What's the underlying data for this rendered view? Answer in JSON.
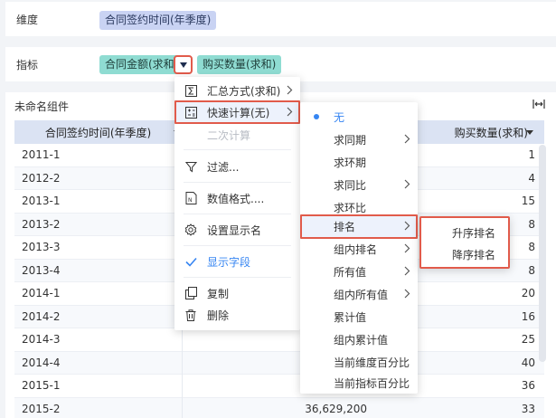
{
  "dimension_row": {
    "label": "维度",
    "field": "合同签约时间(年季度)"
  },
  "metric_row": {
    "label": "指标",
    "fields": [
      "合同金额(求和)",
      "购买数量(求和)"
    ]
  },
  "widget": {
    "title": "未命名组件",
    "expand_icon": "expand-horizontal-icon",
    "columns": [
      "合同签约时间(年季度)",
      "购买数量(求和)"
    ],
    "rows": [
      {
        "period": "2011-1",
        "amount": "",
        "qty": "1"
      },
      {
        "period": "2012-2",
        "amount": "",
        "qty": "4"
      },
      {
        "period": "2013-1",
        "amount": "",
        "qty": "15"
      },
      {
        "period": "2013-2",
        "amount": "",
        "qty": "8"
      },
      {
        "period": "2013-3",
        "amount": "",
        "qty": "8"
      },
      {
        "period": "2013-4",
        "amount": "",
        "qty": "8"
      },
      {
        "period": "2014-1",
        "amount": "",
        "qty": "20"
      },
      {
        "period": "2014-2",
        "amount": "",
        "qty": "16"
      },
      {
        "period": "2014-3",
        "amount": "",
        "qty": "25"
      },
      {
        "period": "2014-4",
        "amount": "",
        "qty": "40"
      },
      {
        "period": "2015-1",
        "amount": "",
        "qty": "36"
      },
      {
        "period": "2015-2",
        "amount": "36,629,200",
        "qty": "33"
      }
    ]
  },
  "field_menu": {
    "items": [
      {
        "label": "汇总方式(求和)",
        "icon": "sigma-icon",
        "submenu": true
      },
      {
        "label": "快速计算(无)",
        "icon": "calculator-icon",
        "submenu": true,
        "highlighted": true
      },
      {
        "label": "二次计算",
        "disabled": true
      },
      {
        "label": "过滤...",
        "icon": "filter-icon"
      },
      {
        "label": "数值格式....",
        "icon": "number-format-icon"
      },
      {
        "label": "设置显示名",
        "icon": "gear-icon"
      },
      {
        "label": "显示字段",
        "icon": "check-icon",
        "active": true
      },
      {
        "label": "复制",
        "icon": "copy-icon"
      },
      {
        "label": "删除",
        "icon": "trash-icon"
      }
    ]
  },
  "quick_calc_menu": {
    "items": [
      {
        "label": "无",
        "selected": true
      },
      {
        "label": "求同期",
        "submenu": true
      },
      {
        "label": "求环期"
      },
      {
        "label": "求同比",
        "submenu": true
      },
      {
        "label": "求环比"
      },
      {
        "label": "排名",
        "submenu": true,
        "highlighted": true
      },
      {
        "label": "组内排名",
        "submenu": true
      },
      {
        "label": "所有值",
        "submenu": true
      },
      {
        "label": "组内所有值",
        "submenu": true
      },
      {
        "label": "累计值"
      },
      {
        "label": "组内累计值"
      },
      {
        "label": "当前维度百分比"
      },
      {
        "label": "当前指标百分比"
      }
    ]
  },
  "rank_menu": {
    "items": [
      "升序排名",
      "降序排名"
    ]
  },
  "colors": {
    "accent": "#3685f2",
    "highlight_border": "#e15b4b",
    "dimension_pill": "#c9d3f3",
    "metric_pill": "#8fdcd2"
  }
}
